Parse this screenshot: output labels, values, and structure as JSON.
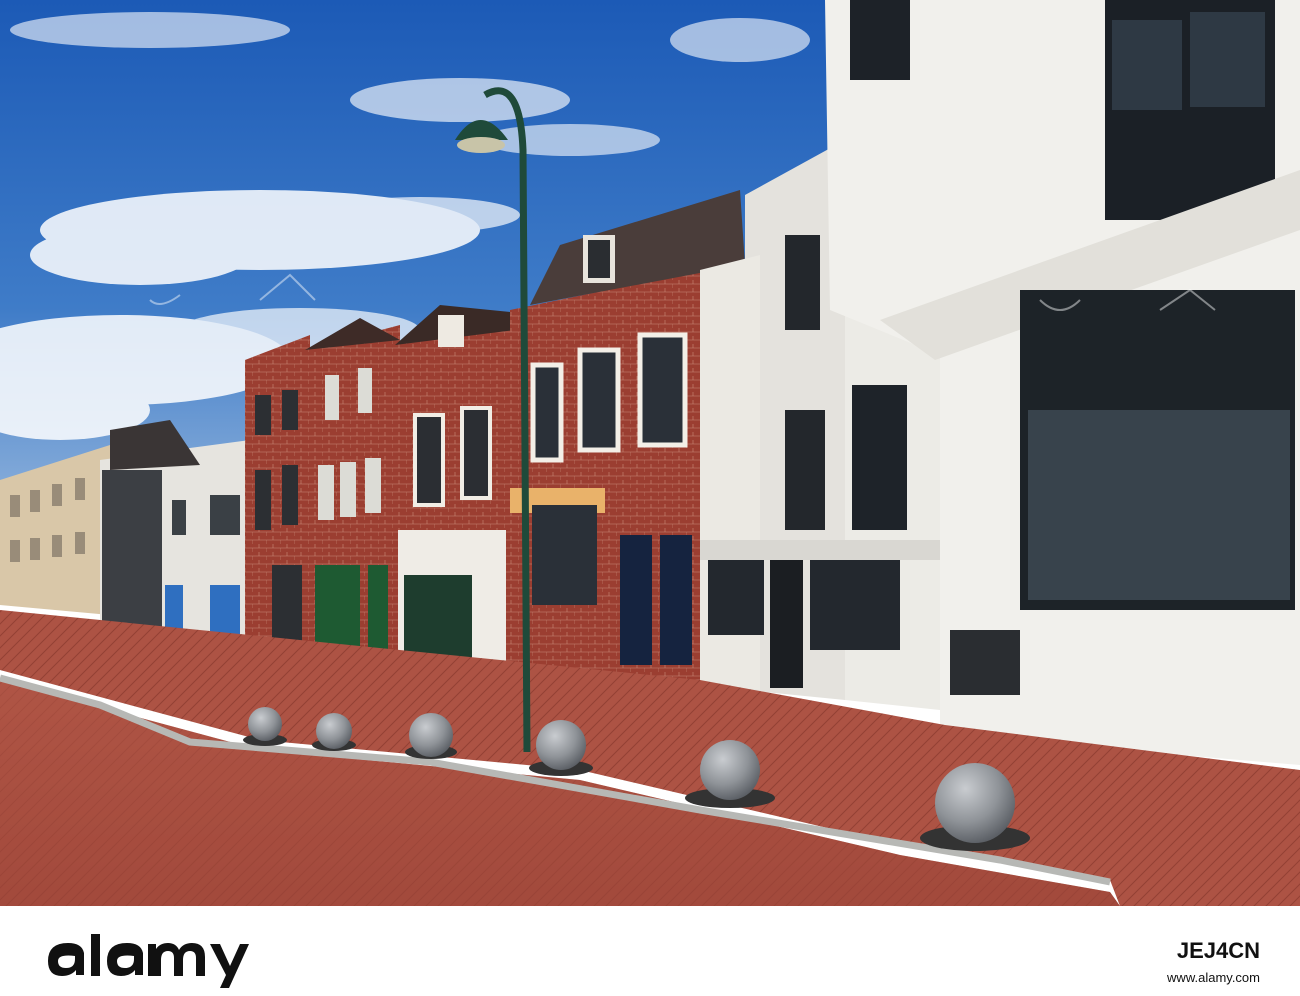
{
  "watermark": {
    "brand": "alamy",
    "image_id": "JEJ4CN",
    "footer_brand": "alamy",
    "footer_url": "www.alamy.com",
    "colors": {
      "footer_text": "#111111",
      "watermark": "#ffffff"
    }
  },
  "scene": {
    "colors": {
      "sky_top": "#1f5fb8",
      "sky_bottom": "#8fb3dc",
      "brick_road": "#a44a3d",
      "brick_plaza": "#b5574a",
      "white_facade": "#ecebe6",
      "red_brick": "#8e3b2e",
      "lamp_green": "#1f4a3a",
      "bollard": "#8d9196"
    }
  }
}
